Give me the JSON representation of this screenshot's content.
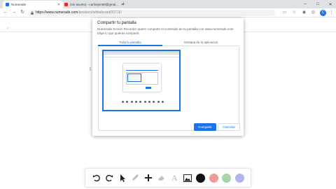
{
  "browser": {
    "tabs": [
      {
        "title": "Numerade",
        "favicon_color": "#1a73e8"
      },
      {
        "title": "(sin asunto) - carlospm88@gmai...",
        "favicon_color": "#d93025"
      }
    ],
    "new_tab_icon": "plus-icon",
    "window_controls": {
      "minimize": "–",
      "maximize": "□",
      "close": "✕"
    },
    "url_host": "https://www.numerade.com",
    "url_path": "/answers/whiteboard/33716/",
    "avatar_letter": "C"
  },
  "dialog": {
    "title": "Compartir tu pantalla",
    "description": "Numerade Screen Recorder quiere compartir el contenido de tu pantalla con www.numerade.com. Elige lo que quieras compartir.",
    "tabs": [
      "Toda la pantalla",
      "Ventana de la aplicacion"
    ],
    "active_tab": 0,
    "share_button": "Compartir",
    "cancel_button": "Cancelar"
  },
  "page": {
    "partial_glyph": "I"
  },
  "drawing_toolbar": {
    "tools": [
      "undo-icon",
      "redo-icon",
      "pointer-icon",
      "pencil-icon",
      "plus-icon",
      "eraser-icon",
      "text-icon",
      "image-icon"
    ],
    "text_tool_glyph": "A",
    "colors": [
      "#111111",
      "#ef9a9a",
      "#a5d6a7",
      "#b3b3f0"
    ]
  },
  "accent": "#1a73e8"
}
